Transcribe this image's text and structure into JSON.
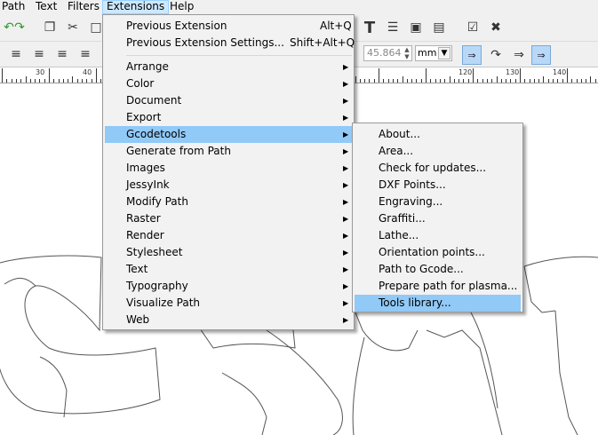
{
  "menubar": {
    "items": [
      {
        "label": "Path",
        "underline": "P"
      },
      {
        "label": "Text",
        "underline": "T"
      },
      {
        "label": "Filters",
        "underline": ""
      },
      {
        "label": "Extensions",
        "underline": "x"
      },
      {
        "label": "Help",
        "underline": "H"
      }
    ]
  },
  "toolbar": {
    "value": "45.864",
    "unit": "mm"
  },
  "ruler": {
    "labels": [
      "30",
      "40",
      "120",
      "130",
      "140"
    ]
  },
  "extensions_menu": {
    "previous_extension": "Previous Extension",
    "previous_extension_shortcut": "Alt+Q",
    "previous_extension_settings": "Previous Extension Settings...",
    "previous_extension_settings_shortcut": "Shift+Alt+Q",
    "items": [
      "Arrange",
      "Color",
      "Document",
      "Export",
      "Gcodetools",
      "Generate from Path",
      "Images",
      "JessyInk",
      "Modify Path",
      "Raster",
      "Render",
      "Stylesheet",
      "Text",
      "Typography",
      "Visualize Path",
      "Web"
    ],
    "highlighted": "Gcodetools"
  },
  "gcodetools_menu": {
    "items": [
      "About...",
      "Area...",
      "Check for updates...",
      "DXF Points...",
      "Engraving...",
      "Graffiti...",
      "Lathe...",
      "Orientation points...",
      "Path to Gcode...",
      "Prepare path for plasma...",
      "Tools library..."
    ],
    "highlighted": "Tools library..."
  }
}
